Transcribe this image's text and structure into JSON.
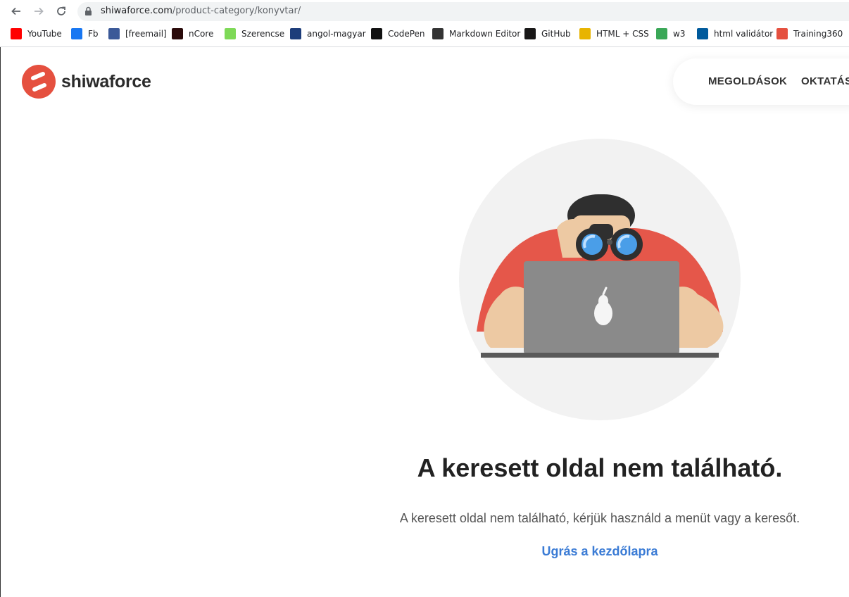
{
  "browser": {
    "url_host": "shiwaforce.com",
    "url_path": "/product-category/konyvtar/",
    "bookmarks": [
      {
        "label": "YouTube",
        "icon": "youtube-icon",
        "color": "#ff0000"
      },
      {
        "label": "Fb",
        "icon": "facebook-icon",
        "color": "#1877f2"
      },
      {
        "label": "[freemail]",
        "icon": "freemail-icon",
        "color": "#3b5998"
      },
      {
        "label": "nCore",
        "icon": "ncore-icon",
        "color": "#2a0a0a"
      },
      {
        "label": "Szerencse",
        "icon": "szerencse-icon",
        "color": "#7ed957"
      },
      {
        "label": "angol-magyar",
        "icon": "dictionary-icon",
        "color": "#1d3d7a"
      },
      {
        "label": "CodePen",
        "icon": "codepen-icon",
        "color": "#111111"
      },
      {
        "label": "Markdown Editor",
        "icon": "markdown-icon",
        "color": "#333333"
      },
      {
        "label": "GitHub",
        "icon": "github-icon",
        "color": "#181717"
      },
      {
        "label": "HTML + CSS",
        "icon": "pencil-icon",
        "color": "#e8b400"
      },
      {
        "label": "w3",
        "icon": "w3-icon",
        "color": "#3aa757"
      },
      {
        "label": "html validátor",
        "icon": "w3c-icon",
        "color": "#005a9c"
      },
      {
        "label": "Training360",
        "icon": "training360-icon",
        "color": "#e5503f"
      }
    ]
  },
  "site": {
    "logo_text": "shiwaforce",
    "nav": [
      "MEGOLDÁSOK",
      "OKTATÁS"
    ]
  },
  "content": {
    "title": "A keresett oldal nem található.",
    "message": "A keresett oldal nem található, kérjük használd a menüt vagy a keresőt.",
    "home_link": "Ugrás a kezdőlapra"
  },
  "colors": {
    "brand": "#e5503f",
    "link": "#3a7bd5"
  }
}
